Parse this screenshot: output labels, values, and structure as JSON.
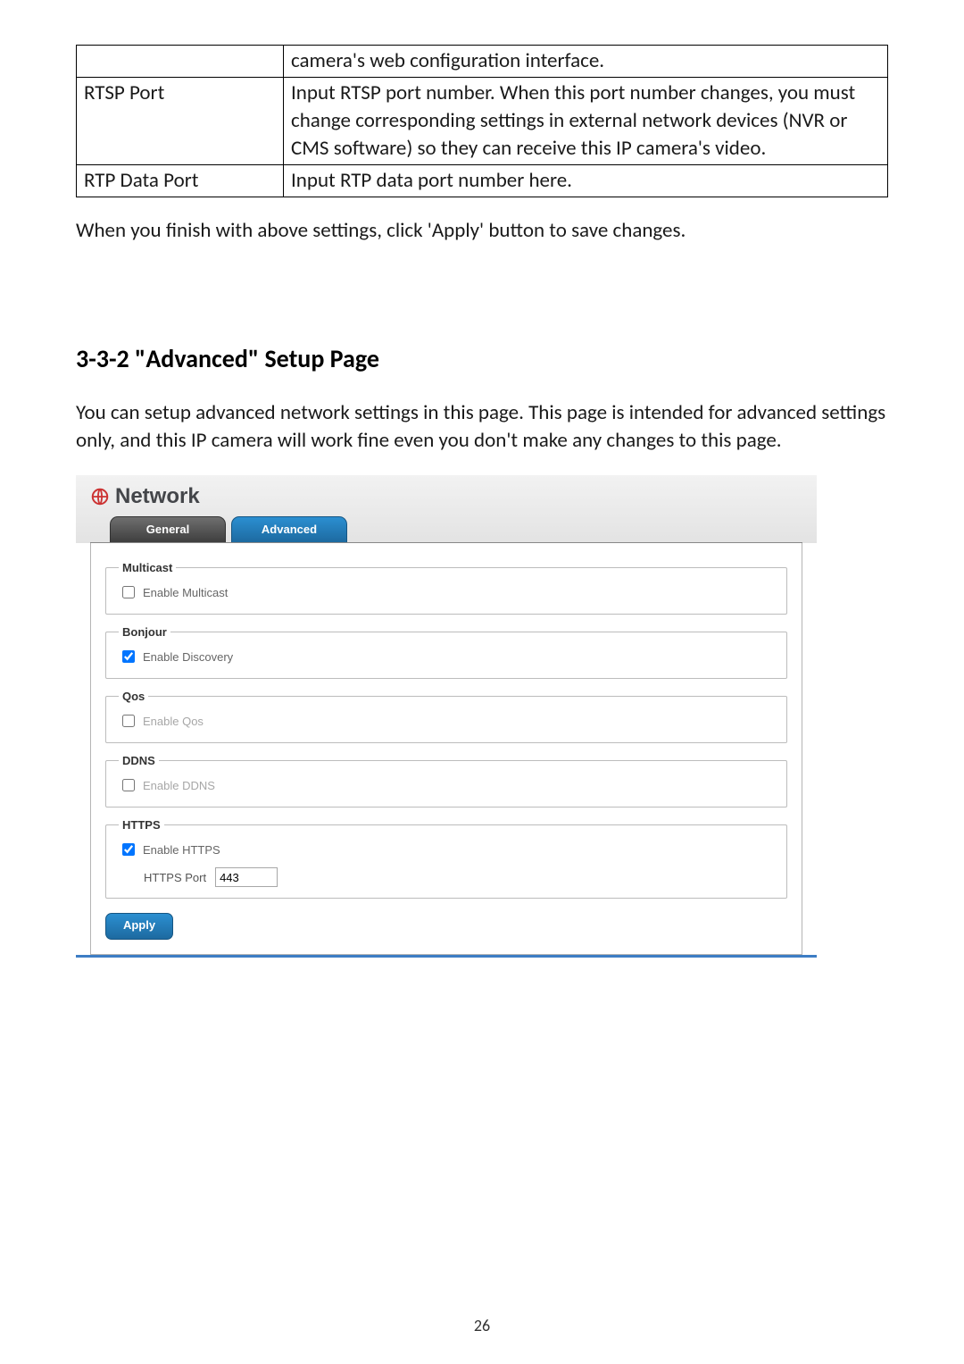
{
  "table": {
    "rows": [
      {
        "left": "",
        "right": "camera's web configuration interface."
      },
      {
        "left": "RTSP Port",
        "right": "Input RTSP port number. When this port number changes, you must change corresponding settings in external network devices (NVR or CMS software) so they can receive this IP camera's video."
      },
      {
        "left": "RTP Data Port",
        "right": "Input RTP data port number here."
      }
    ]
  },
  "para_after_table": "When you finish with above settings, click 'Apply' button to save changes.",
  "section_heading": "3-3-2 \"Advanced\" Setup Page",
  "section_intro": "You can setup advanced network settings in this page. This page is intended for advanced settings only, and this IP camera will work fine even you don't make any changes to this page.",
  "screenshot": {
    "title": "Network",
    "tabs": {
      "general": "General",
      "advanced": "Advanced"
    },
    "groups": {
      "multicast": {
        "legend": "Multicast",
        "checkbox": "Enable Multicast",
        "checked": false
      },
      "bonjour": {
        "legend": "Bonjour",
        "checkbox": "Enable Discovery",
        "checked": true
      },
      "qos": {
        "legend": "Qos",
        "checkbox": "Enable Qos",
        "checked": false
      },
      "ddns": {
        "legend": "DDNS",
        "checkbox": "Enable DDNS",
        "checked": false
      },
      "https": {
        "legend": "HTTPS",
        "checkbox": "Enable HTTPS",
        "checked": true,
        "port_label": "HTTPS Port",
        "port_value": "443"
      }
    },
    "apply_label": "Apply"
  },
  "page_number": "26"
}
